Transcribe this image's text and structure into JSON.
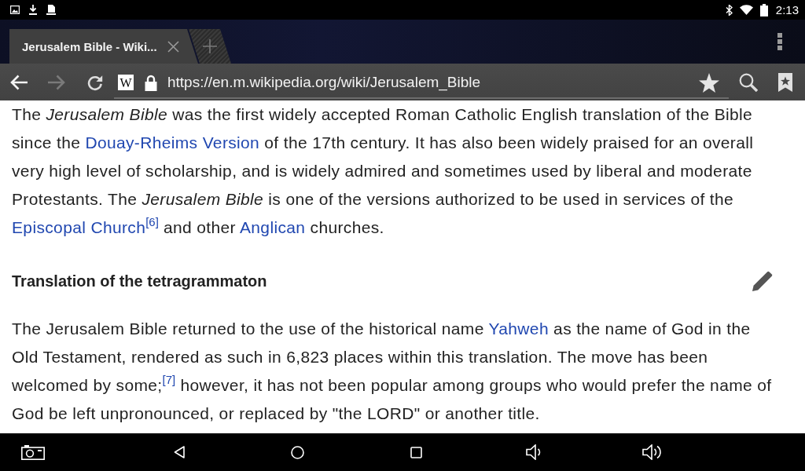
{
  "status_bar": {
    "time": "2:13"
  },
  "tabs": [
    {
      "label": "Jerusalem Bible - Wiki...",
      "selected": true
    }
  ],
  "toolbar": {
    "back": {
      "disabled": false
    },
    "forward": {
      "disabled": true
    },
    "site_icon": "W",
    "url": "https://en.m.wikipedia.org/wiki/Jerusalem_Bible"
  },
  "article": [
    {
      "kind": "paragraph",
      "runs": [
        {
          "kind": "text",
          "text": "The *Jerusalem Bible* was the first widely accepted Roman Catholic English translation of the Bible since the "
        },
        {
          "kind": "link",
          "text": "Douay-Rheims Version"
        },
        {
          "kind": "text",
          "text": " of the 17th century. It has also been widely praised for an overall very high level of scholarship, and is widely admired and sometimes used by liberal and moderate Protestants. The *Jerusalem Bible* is one of the versions authorized to be used in services of the "
        },
        {
          "kind": "link",
          "text": "Episcopal Church"
        },
        {
          "kind": "ref",
          "text": "[6]"
        },
        {
          "kind": "text",
          "text": " and other "
        },
        {
          "kind": "link",
          "text": "Anglican"
        },
        {
          "kind": "text",
          "text": " churches."
        }
      ]
    },
    {
      "kind": "heading",
      "text": "Translation of the tetragrammaton"
    },
    {
      "kind": "paragraph",
      "runs": [
        {
          "kind": "text",
          "text": "The Jerusalem Bible returned to the use of the historical name "
        },
        {
          "kind": "link",
          "text": "Yahweh"
        },
        {
          "kind": "text",
          "text": " as the name of God in the Old Testament, rendered as such in 6,823 places within this translation. The move has been welcomed by some;"
        },
        {
          "kind": "ref",
          "text": "[7]"
        },
        {
          "kind": "text",
          "text": " however, it has not been popular among groups who would prefer the name of God be left unpronounced, or replaced by \"the LORD\" or another title."
        }
      ]
    }
  ]
}
